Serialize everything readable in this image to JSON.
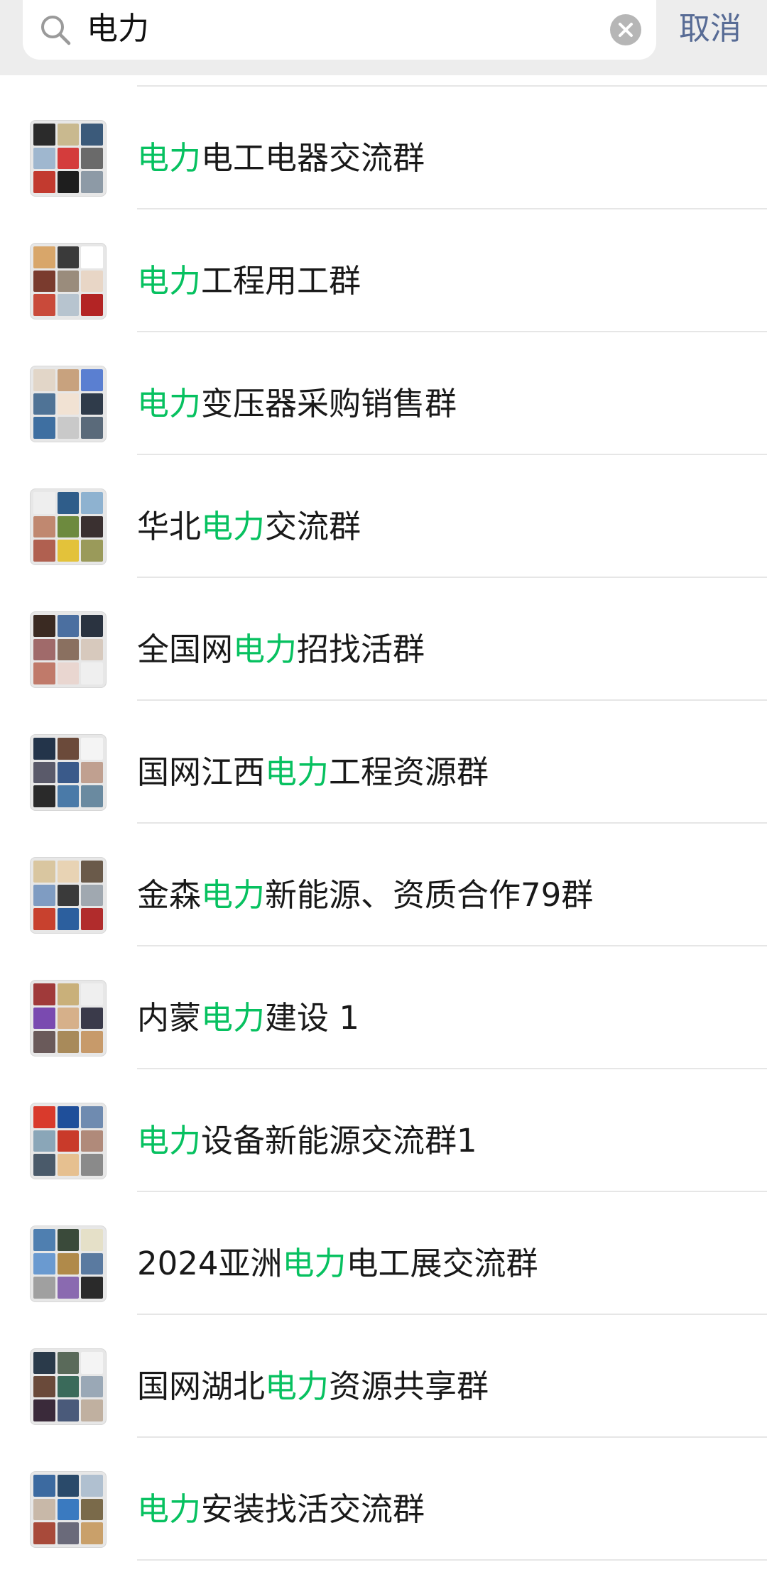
{
  "search": {
    "query": "电力",
    "cancel_label": "取消"
  },
  "colors": {
    "highlight": "#07c160",
    "cancel": "#576b95",
    "text": "#191919",
    "header_bg": "#ededed"
  },
  "icons": {
    "search": "search-icon",
    "clear": "clear-icon"
  },
  "results": [
    {
      "pre": "",
      "match": "电力",
      "post": "电工电器交流群"
    },
    {
      "pre": "",
      "match": "电力",
      "post": "工程用工群"
    },
    {
      "pre": "",
      "match": "电力",
      "post": "变压器采购销售群"
    },
    {
      "pre": "华北",
      "match": "电力",
      "post": "交流群"
    },
    {
      "pre": "全国网",
      "match": "电力",
      "post": "招找活群"
    },
    {
      "pre": "国网江西",
      "match": "电力",
      "post": "工程资源群"
    },
    {
      "pre": "金森",
      "match": "电力",
      "post": "新能源、资质合作79群"
    },
    {
      "pre": "内蒙",
      "match": "电力",
      "post": "建设 1"
    },
    {
      "pre": "",
      "match": "电力",
      "post": "设备新能源交流群1"
    },
    {
      "pre": "2024亚洲",
      "match": "电力",
      "post": "电工展交流群"
    },
    {
      "pre": "国网湖北",
      "match": "电力",
      "post": "资源共享群"
    },
    {
      "pre": "",
      "match": "电力",
      "post": "安装找活交流群"
    }
  ]
}
